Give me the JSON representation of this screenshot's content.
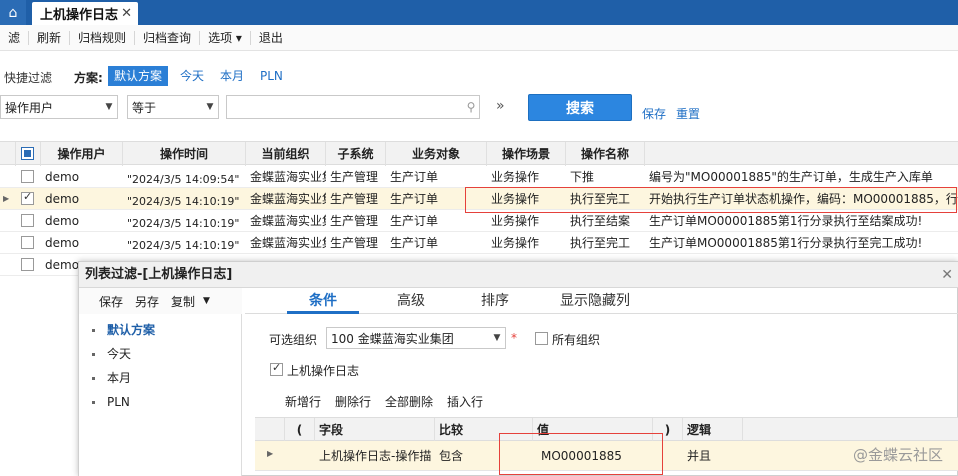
{
  "tabbar": {
    "home_icon": "home-icon",
    "tab_title": "上机操作日志",
    "close_glyph": "✕"
  },
  "toolbar": [
    "滤",
    "刷新",
    "归档规则",
    "归档查询",
    "选项 ▾",
    "退出"
  ],
  "quick_filter": {
    "label": "快捷过滤",
    "scheme_label": "方案:",
    "schemes": [
      "默认方案",
      "今天",
      "本月",
      "PLN"
    ],
    "field_select": "操作用户",
    "operator_select": "等于",
    "value_input": "",
    "search_button": "搜索",
    "save_link": "保存",
    "reset_link": "重置",
    "expand_glyph": "»"
  },
  "grid": {
    "columns": [
      "操作用户",
      "操作时间",
      "当前组织",
      "子系统",
      "业务对象",
      "操作场景",
      "操作名称"
    ],
    "rows": [
      {
        "checked": false,
        "user": "demo",
        "time": "\"2024/3/5 14:09:54\"",
        "org": "金蝶蓝海实业集",
        "subsys": "生产管理",
        "object": "生产订单",
        "scene": "业务操作",
        "op": "下推",
        "desc": "编号为\"MO00001885\"的生产订单，生成生产入库单"
      },
      {
        "checked": true,
        "user": "demo",
        "time": "\"2024/3/5 14:10:19\"",
        "org": "金蝶蓝海实业集",
        "subsys": "生产管理",
        "object": "生产订单",
        "scene": "业务操作",
        "op": "执行至完工",
        "desc": "开始执行生产订单状态机操作，编码：MO00001885，行号"
      },
      {
        "checked": false,
        "user": "demo",
        "time": "\"2024/3/5 14:10:19\"",
        "org": "金蝶蓝海实业集",
        "subsys": "生产管理",
        "object": "生产订单",
        "scene": "业务操作",
        "op": "执行至结案",
        "desc": "生产订单MO00001885第1行分录执行至结案成功!"
      },
      {
        "checked": false,
        "user": "demo",
        "time": "\"2024/3/5 14:10:19\"",
        "org": "金蝶蓝海实业集",
        "subsys": "生产管理",
        "object": "生产订单",
        "scene": "业务操作",
        "op": "执行至完工",
        "desc": "生产订单MO00001885第1行分录执行至完工成功!"
      },
      {
        "checked": false,
        "user": "demo",
        "time": "",
        "org": "",
        "subsys": "",
        "object": "",
        "scene": "",
        "op": "",
        "desc": ""
      }
    ]
  },
  "dialog": {
    "title": "列表过滤-[上机操作日志]",
    "close_glyph": "✕",
    "left_toolbar": [
      "保存",
      "另存",
      "复制"
    ],
    "schemes": [
      "默认方案",
      "今天",
      "本月",
      "PLN"
    ],
    "tabs": [
      "条件",
      "高级",
      "排序",
      "显示隐藏列"
    ],
    "org_label": "可选组织",
    "org_value": "100 金蝶蓝海实业集团",
    "required_mark": "*",
    "all_org_label": "所有组织",
    "log_check_label": "上机操作日志",
    "sub_toolbar": [
      "新增行",
      "删除行",
      "全部删除",
      "插入行"
    ],
    "cond_columns": [
      "(",
      "字段",
      "比较",
      "值",
      ")",
      "逻辑"
    ],
    "cond_row": {
      "field": "上机操作日志-操作描",
      "compare": "包含",
      "value": "MO00001885",
      "logic": "并且"
    }
  },
  "watermark": "@金蝶云社区",
  "colors": {
    "tabbar": "#1f5fa8",
    "accent": "#2b7fd6",
    "highlight": "#e5413b"
  }
}
